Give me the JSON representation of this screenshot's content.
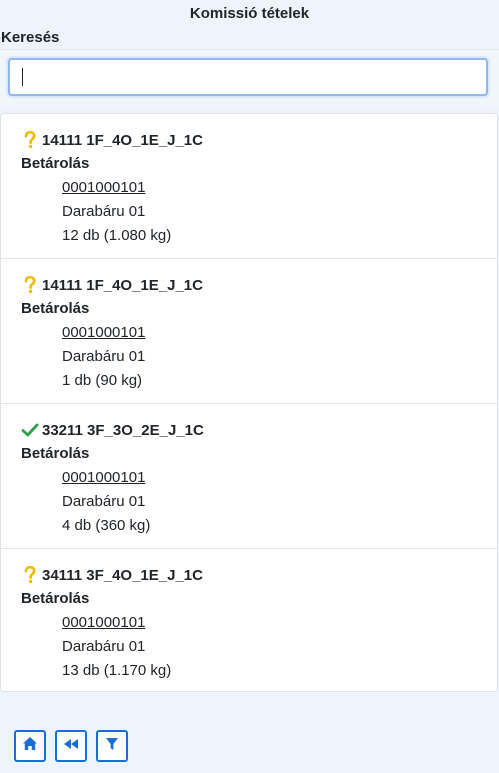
{
  "page": {
    "title": "Komissió tételek"
  },
  "search": {
    "label": "Keresés",
    "value": "",
    "placeholder": ""
  },
  "items": [
    {
      "status": "question",
      "code": "14111 1F_4O_1E_J_1C",
      "type": "Betárolás",
      "ref": "0001000101",
      "product": "Darabáru 01",
      "qty": "12 db (1.080 kg)"
    },
    {
      "status": "question",
      "code": "14111 1F_4O_1E_J_1C",
      "type": "Betárolás",
      "ref": "0001000101",
      "product": "Darabáru 01",
      "qty": "1 db (90 kg)"
    },
    {
      "status": "done",
      "code": "33211 3F_3O_2E_J_1C",
      "type": "Betárolás",
      "ref": "0001000101",
      "product": "Darabáru 01",
      "qty": "4 db (360 kg)"
    },
    {
      "status": "question",
      "code": "34111 3F_4O_1E_J_1C",
      "type": "Betárolás",
      "ref": "0001000101",
      "product": "Darabáru 01",
      "qty": "13 db (1.170 kg)"
    }
  ],
  "toolbar": {
    "buttons": [
      {
        "icon": "home-icon"
      },
      {
        "icon": "backward-icon"
      },
      {
        "icon": "filter-icon"
      }
    ]
  },
  "colors": {
    "accent": "#1a6fd6",
    "question": "#f5b800",
    "done": "#2e9e48"
  }
}
